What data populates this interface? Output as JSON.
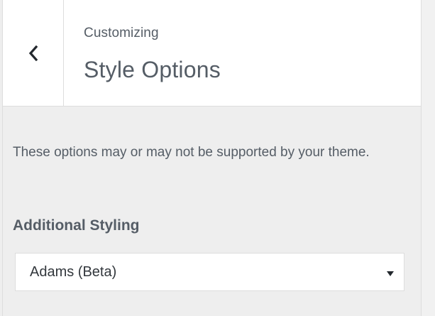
{
  "header": {
    "back_icon": "chevron-left-icon",
    "kicker": "Customizing",
    "title": "Style Options"
  },
  "section": {
    "description": "These options may or may not be supported by your theme.",
    "control": {
      "label": "Additional Styling",
      "selected_value": "Adams (Beta)",
      "arrow_icon": "dropdown-arrow-icon"
    }
  },
  "colors": {
    "header_bg": "#ffffff",
    "panel_bg": "#eeeeee",
    "text": "#555d66",
    "border": "#dddddd"
  }
}
